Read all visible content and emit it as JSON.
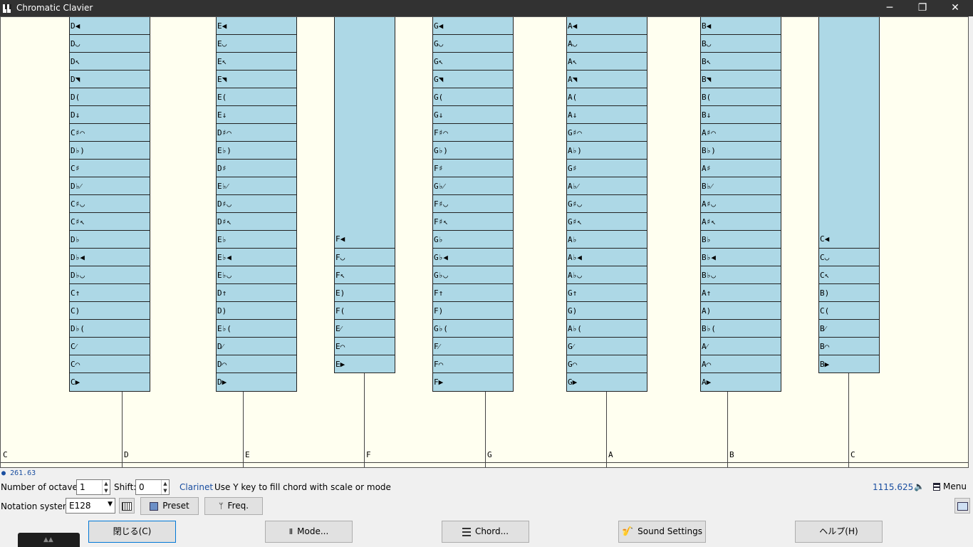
{
  "window": {
    "title": "Chromatic Clavier",
    "minimize_glyph": "─",
    "restore_glyph": "❐",
    "close_glyph": "✕"
  },
  "keyboard": {
    "white_keys": [
      "C",
      "D",
      "E",
      "F",
      "G",
      "A",
      "B",
      "C"
    ],
    "black_keys": [
      {
        "root": "D",
        "tones": [
          "D◀",
          "D◡",
          "D↖",
          "D◥",
          "D(",
          "D↓",
          "C♯⌒",
          "D♭)",
          "C♯",
          "D♭⁄",
          "C♯◡",
          "C♯↖",
          "D♭",
          "D♭◀",
          "D♭◡",
          "C↑",
          "C)",
          "D♭(",
          "C⁄",
          "C⌒",
          "C▶"
        ]
      },
      {
        "root": "E",
        "tones": [
          "E◀",
          "E◡",
          "E↖",
          "E◥",
          "E(",
          "E↓",
          "D♯⌒",
          "E♭)",
          "D♯",
          "E♭⁄",
          "D♯◡",
          "D♯↖",
          "E♭",
          "E♭◀",
          "E♭◡",
          "D↑",
          "D)",
          "E♭(",
          "D⁄",
          "D⌒",
          "D▶"
        ]
      },
      {
        "root": "F",
        "tones": [
          "F◀",
          "F◡",
          "F↖",
          "E)",
          "F(",
          "E⁄",
          "E⌒",
          "E▶"
        ]
      },
      {
        "root": "G",
        "tones": [
          "G◀",
          "G◡",
          "G↖",
          "G◥",
          "G(",
          "G↓",
          "F♯⌒",
          "G♭)",
          "F♯",
          "G♭⁄",
          "F♯◡",
          "F♯↖",
          "G♭",
          "G♭◀",
          "G♭◡",
          "F↑",
          "F)",
          "G♭(",
          "F⁄",
          "F⌒",
          "F▶"
        ]
      },
      {
        "root": "A",
        "tones": [
          "A◀",
          "A◡",
          "A↖",
          "A◥",
          "A(",
          "A↓",
          "G♯⌒",
          "A♭)",
          "G♯",
          "A♭⁄",
          "G♯◡",
          "G♯↖",
          "A♭",
          "A♭◀",
          "A♭◡",
          "G↑",
          "G)",
          "A♭(",
          "G⁄",
          "G⌒",
          "G▶"
        ]
      },
      {
        "root": "B",
        "tones": [
          "B◀",
          "B◡",
          "B↖",
          "B◥",
          "B(",
          "B↓",
          "A♯⌒",
          "B♭)",
          "A♯",
          "B♭⁄",
          "A♯◡",
          "A♯↖",
          "B♭",
          "B♭◀",
          "B♭◡",
          "A↑",
          "A)",
          "B♭(",
          "A⁄",
          "A⌒",
          "A▶"
        ]
      },
      {
        "root": "C",
        "tones": [
          "C◀",
          "C◡",
          "C↖",
          "B)",
          "C(",
          "B⁄",
          "B⌒",
          "B▶"
        ]
      }
    ]
  },
  "status": {
    "frequency_readout": "261.63",
    "frequency_right": "1115.625",
    "instrument": "Clarinet",
    "hint": "Use Y key to fill chord with scale or mode"
  },
  "controls": {
    "octaves_label": "Number of octaves:",
    "octaves_value": "1",
    "shift_label": "Shift:",
    "shift_value": "0",
    "notation_label": "Notation system:",
    "notation_value": "E128",
    "preset_label": "Preset",
    "freq_label": "Freq.",
    "menu_label": "Menu"
  },
  "footer": {
    "close_label": "閉じる(C)",
    "mode_label": "Mode...",
    "chord_label": "Chord...",
    "sound_settings_label": "Sound Settings",
    "help_label": "ヘルプ(H)"
  },
  "colors": {
    "black_key": "#add8e6",
    "keyboard_bg": "#fffff0",
    "accent_text": "#1a4ea0"
  }
}
